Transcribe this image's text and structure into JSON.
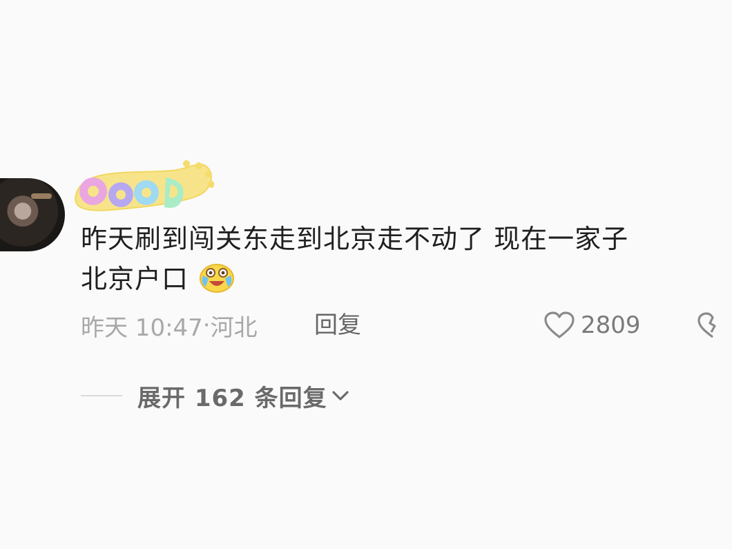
{
  "comment": {
    "sticker_text": "GOOD",
    "text_line1": "昨天刷到闯关东走到北京走不动了 现在一家子",
    "text_line2": "北京户口",
    "emoji": "laughing-crying-emoji",
    "time": "昨天 10:47",
    "separator": "·",
    "location": "河北",
    "reply_label": "回复",
    "likes": "2809"
  },
  "replies": {
    "expand_label": "展开 162 条回复"
  },
  "icons": {
    "like": "heart-outline-icon",
    "dislike": "broken-heart-icon",
    "expand": "chevron-down-icon"
  }
}
